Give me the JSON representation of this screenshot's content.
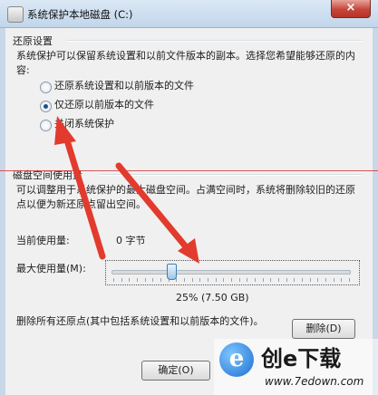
{
  "window": {
    "title": "系统保护本地磁盘 (C:)",
    "close_glyph": "×"
  },
  "restore": {
    "group_title": "还原设置",
    "description": "系统保护可以保留系统设置和以前文件版本的副本。选择您希望能够还原的内容:",
    "options": [
      {
        "label": "还原系统设置和以前版本的文件",
        "checked": false
      },
      {
        "label": "仅还原以前版本的文件",
        "checked": true
      },
      {
        "label": "关闭系统保护",
        "checked": false
      }
    ]
  },
  "disk": {
    "group_title": "磁盘空间使用量",
    "description": "可以调整用于系统保护的最大磁盘空间。占满空间时，系统将删除较旧的还原点以便为新还原点留出空间。",
    "current_label": "当前使用量:",
    "current_value": "0 字节",
    "max_label": "最大使用量(M):",
    "slider_percent": 25,
    "slider_readout": "25% (7.50 GB)"
  },
  "delete": {
    "text": "删除所有还原点(其中包括系统设置和以前版本的文件)。",
    "button_label": "删除(D)"
  },
  "footer": {
    "ok_label": "确定(O)"
  },
  "watermark": {
    "logo_letter": "e",
    "title": "创e下载",
    "url": "www.7edown.com"
  },
  "colors": {
    "arrow_red": "#e23b2e",
    "titlebar": "#c9d8e8",
    "panel": "#f0f0f0"
  }
}
